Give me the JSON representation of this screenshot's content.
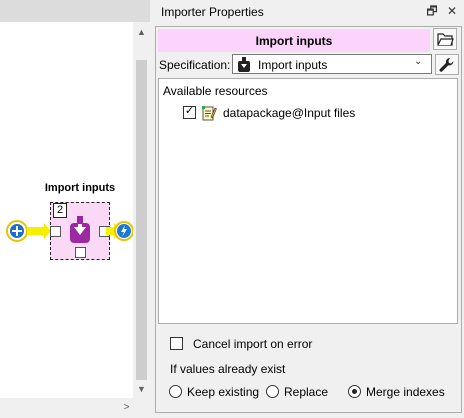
{
  "design_view": {
    "node": {
      "title": "Import inputs",
      "badge": "2"
    },
    "scroll": {
      "up_arrow": "▲",
      "down_arrow": "▼",
      "left_arrow": "<",
      "right_arrow": ">"
    }
  },
  "dock": {
    "title": "Importer Properties",
    "float_button": "🗗",
    "close_button": "✕",
    "item_name": "Import inputs",
    "specification": {
      "label": "Specification:",
      "value": "Import inputs",
      "chevron": "⌄"
    },
    "resources": {
      "header": "Available resources",
      "items": [
        {
          "label": "datapackage@Input files",
          "checked": true,
          "check_mark": "✓"
        }
      ]
    },
    "cancel_on_error": {
      "label": "Cancel import on error",
      "checked": false
    },
    "existing_values": {
      "label": "If values already exist",
      "options": [
        {
          "label": "Keep existing",
          "selected": false
        },
        {
          "label": "Replace",
          "selected": false
        },
        {
          "label": "Merge indexes",
          "selected": true
        }
      ]
    }
  },
  "colors": {
    "item_accent": "#fbd3fb",
    "node_fill": "#f9d9f6",
    "importer_purple": "#9b2aa0",
    "link_yellow": "#f5f000",
    "tool_blue": "#1e78d2"
  },
  "icons": {
    "folder": "open-folder-icon",
    "wrench": "wrench-icon",
    "importer": "importer-icon",
    "datapackage": "datapackage-icon",
    "data_connection": "data-connection-icon",
    "tool": "tool-icon"
  }
}
